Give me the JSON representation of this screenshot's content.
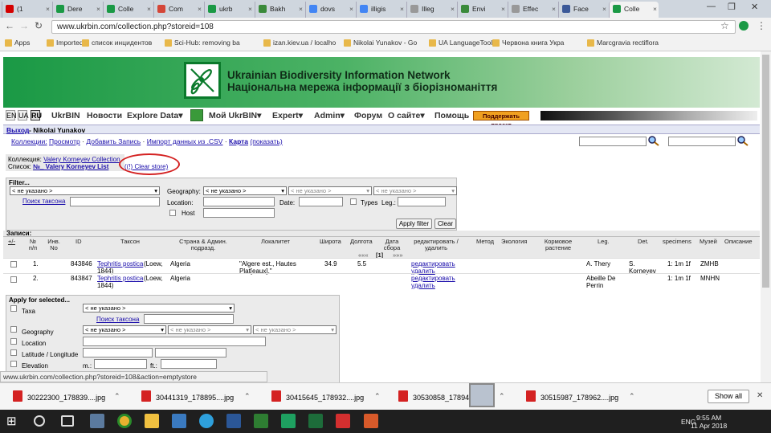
{
  "tabs": [
    {
      "label": "(1",
      "color": "#d40000"
    },
    {
      "label": "Dere",
      "color": "#1a9945"
    },
    {
      "label": "Colle",
      "color": "#1a9945"
    },
    {
      "label": "Com",
      "color": "#d44638"
    },
    {
      "label": "ukrb",
      "color": "#1a9945"
    },
    {
      "label": "Bakh",
      "color": "#3a8a3a"
    },
    {
      "label": "dovs",
      "color": "#4285f4"
    },
    {
      "label": "illigis",
      "color": "#4285f4"
    },
    {
      "label": "Illeg",
      "color": "#999999"
    },
    {
      "label": "Envi",
      "color": "#3a8a3a"
    },
    {
      "label": "Effec",
      "color": "#999999"
    },
    {
      "label": "Face",
      "color": "#3b5998"
    },
    {
      "label": "Colle",
      "color": "#1a9945"
    }
  ],
  "address": "www.ukrbin.com/collection.php?storeid=108",
  "bookmarks": [
    "Apps",
    "Imported",
    "список инцидентов",
    "Sci-Hub: removing ba",
    "izan.kiev.ua / localho",
    "Nikolai Yunakov - Go",
    "UA LanguageTool",
    "Червона книга Укра",
    "Marcgravia rectiflora"
  ],
  "banner": {
    "title_en": "Ukrainian Biodiversity Information Network",
    "title_ua": "Національна мережа інформації з біорізноманіття"
  },
  "langs": [
    "EN",
    "UA",
    "RU"
  ],
  "nav": [
    "UkrBIN",
    "Новости",
    "Explore Data",
    "Мой UkrBIN",
    "Expert",
    "Admin",
    "Форум",
    "О сайте",
    "Помощь"
  ],
  "donate": "Поддержать проект",
  "user": {
    "logout": "Выход",
    "name": "Nikolai Yunakov"
  },
  "links": {
    "collections": "Коллекции:",
    "view": "Просмотр",
    "add": "Добавить Запись",
    "import": "Импорт данных из .CSV",
    "map": "Карта",
    "show": "(показать)"
  },
  "collection": {
    "label": "Коллекция:",
    "name": "Valery Korneyev Collection",
    "list_label": "Список:",
    "list_name": "№_ Valery Korneyev List",
    "clear": "((!) Clear store)"
  },
  "filter": {
    "title": "Filter...",
    "not_set": "< не указано >",
    "search_taxon": "Поиск таксона",
    "geography": "Geography:",
    "location": "Location:",
    "date": "Date:",
    "types": "Types",
    "leg": "Leg.:",
    "host": "Host",
    "apply": "Apply filter",
    "clear": "Clear"
  },
  "records": {
    "title": "Записи:",
    "headers": [
      "+/-",
      "№ п/п",
      "Инв. No",
      "ID",
      "Таксон",
      "Страна & Админ. подразд.",
      "Локалитет",
      "Широта",
      "Долгота",
      "Дата сбора",
      "редактировать / удалить",
      "Метод",
      "Экология",
      "Кормовое растение",
      "Leg.",
      "Det.",
      "specimens",
      "Музей",
      "Описание"
    ],
    "pager": {
      "prev": "«««",
      "page": "[1]",
      "next": "»»»"
    },
    "rows": [
      {
        "n": "1.",
        "id": "843846",
        "taxon": "Tephritis postica",
        "author": "(Loew,",
        "author2": "1844)",
        "country": "Algeria",
        "loc": "\"Algere est., Hautes",
        "loc2": "Plat[eaux].\"",
        "lat": "34.9",
        "lon": "5.5",
        "edit": "редактировать",
        "del": "удалить",
        "leg": "A. Thery",
        "det": "S.",
        "det2": "Korneyev",
        "spec": "1: 1m 1f",
        "museum": "ZMHB"
      },
      {
        "n": "2.",
        "id": "843847",
        "taxon": "Tephritis postica",
        "author": "(Loew,",
        "author2": "1844)",
        "country": "Algeria",
        "loc": "",
        "loc2": "",
        "lat": "",
        "lon": "",
        "edit": "редактировать",
        "del": "удалить",
        "leg": "Abeille De",
        "leg2": "Perrin",
        "det": "",
        "det2": "",
        "spec": "1: 1m 1f",
        "museum": "MNHN"
      }
    ]
  },
  "apply": {
    "title": "Apply for selected...",
    "taxa": "Taxa",
    "search_taxon": "Поиск таксона",
    "geography": "Geography",
    "location": "Location",
    "latlon": "Latitude / Longitude",
    "elevation": "Elevation",
    "m": "m.:",
    "ft": "ft.:"
  },
  "status_url": "www.ukrbin.com/collection.php?storeid=108&action=emptystore",
  "downloads": [
    "30222300_178839....jpg",
    "30441319_178895....jpg",
    "30415645_178932....jpg",
    "30530858_178949....jpg",
    "30515987_178962....jpg"
  ],
  "show_all": "Show all",
  "taskbar": {
    "lang": "ENG",
    "time": "9:55 AM",
    "date": "11 Apr 2018"
  }
}
